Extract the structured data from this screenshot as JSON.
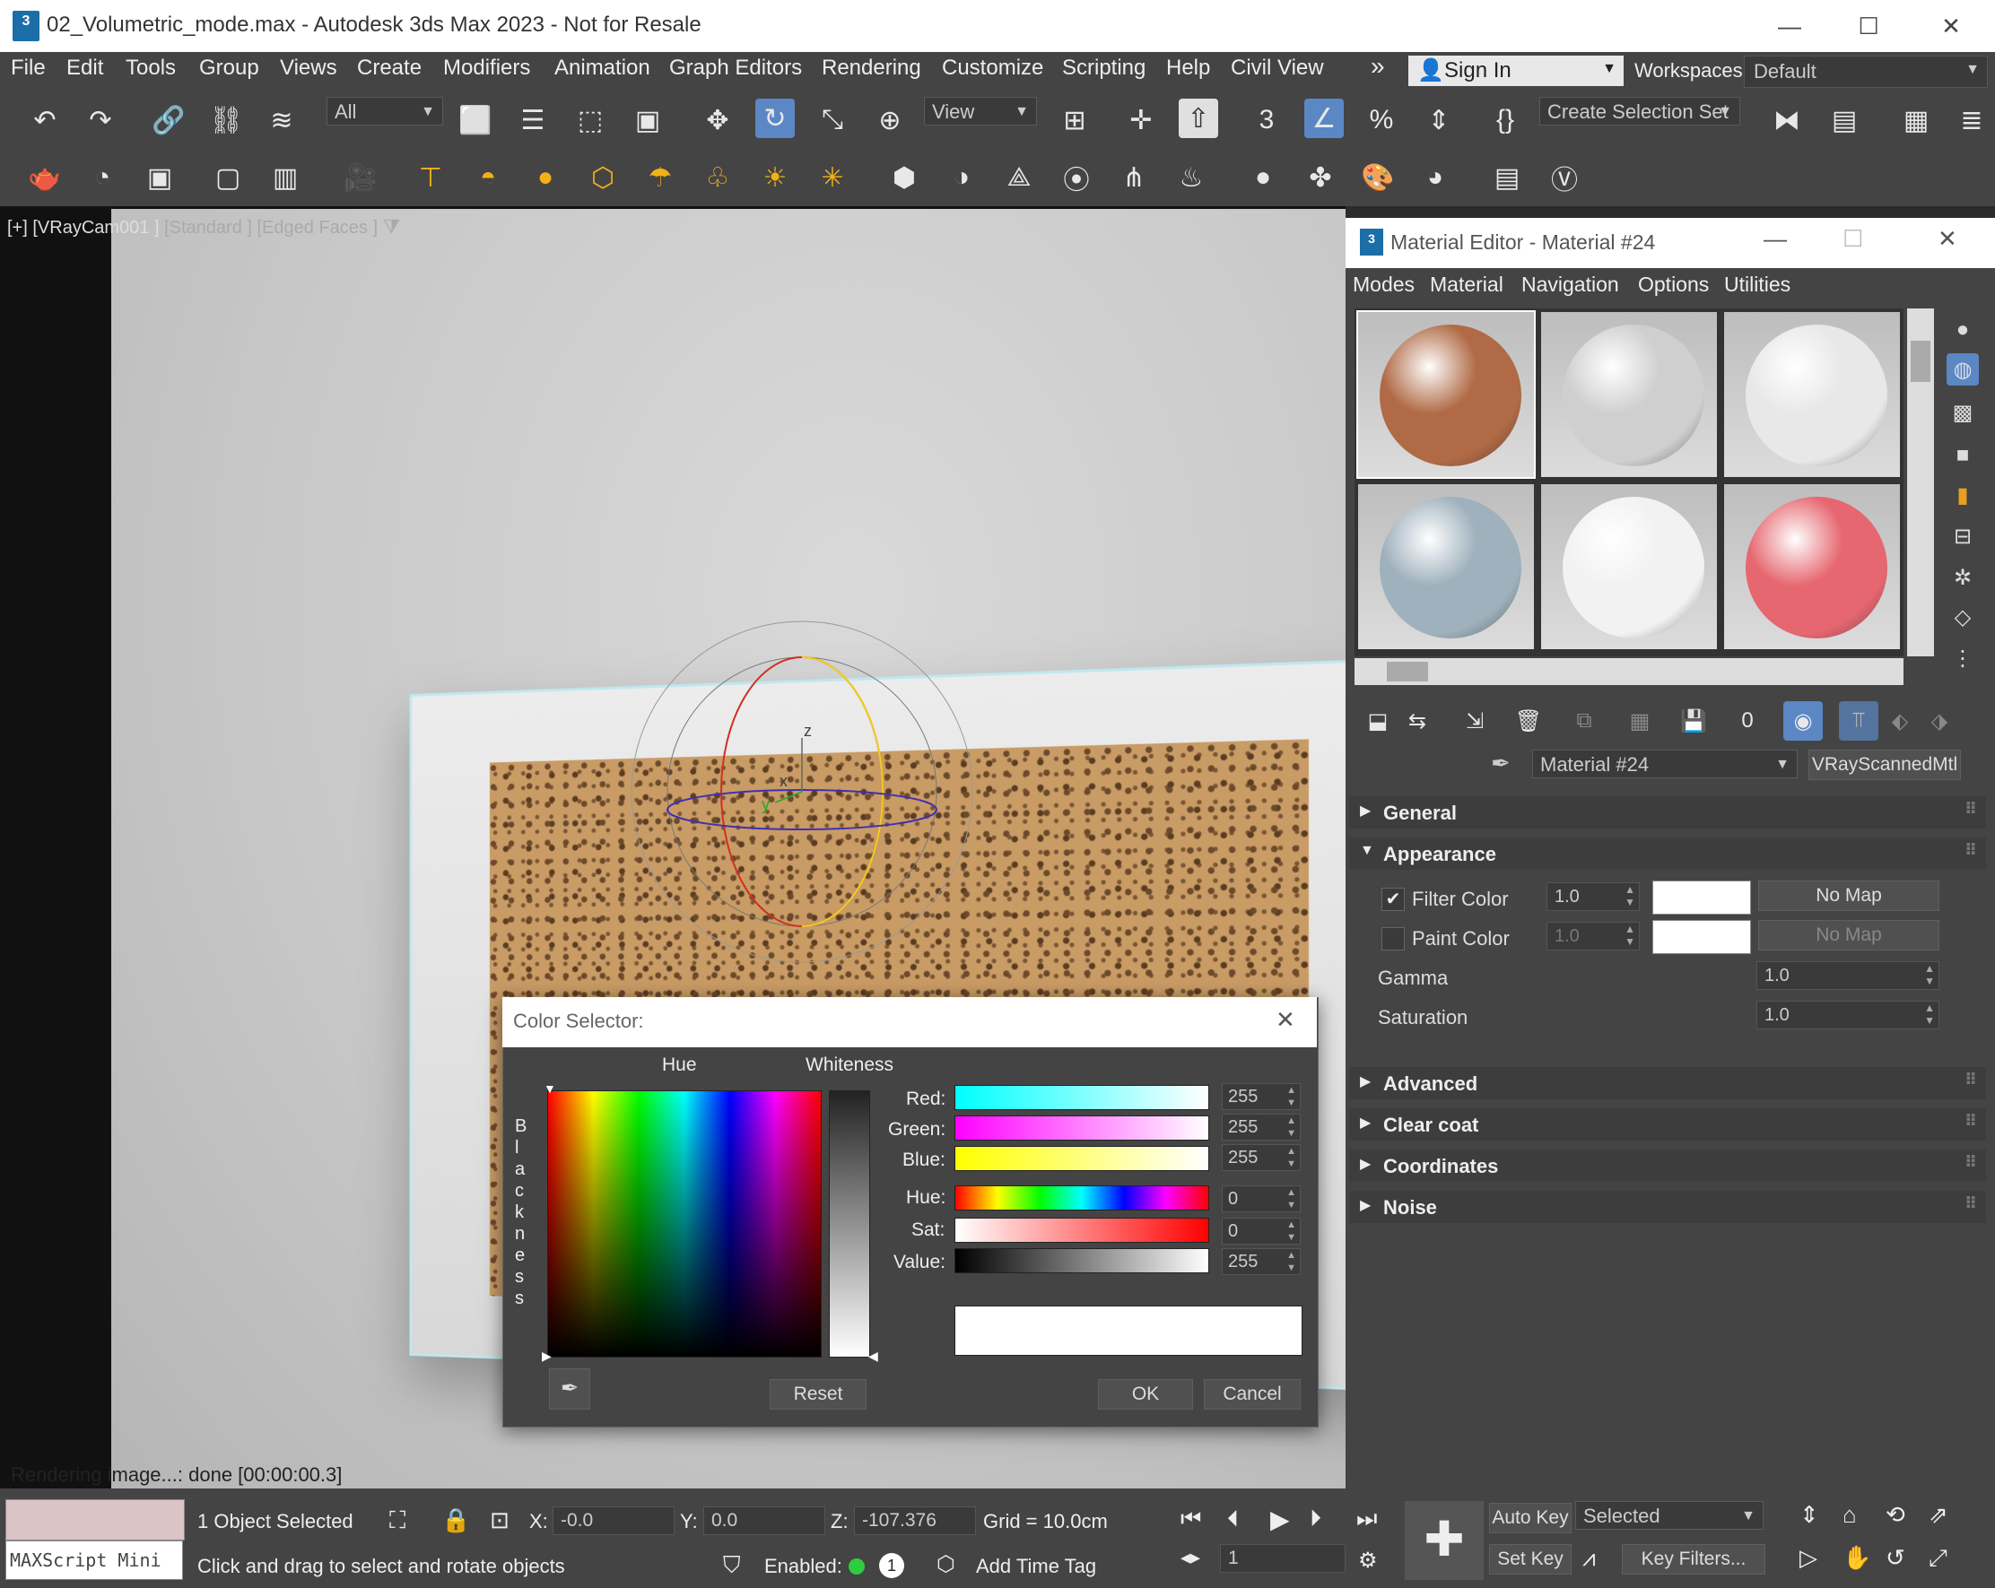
{
  "window": {
    "app_icon": "3",
    "title": "02_Volumetric_mode.max - Autodesk 3ds Max 2023 - Not for Resale",
    "minimize": "—",
    "maximize": "☐",
    "close": "✕"
  },
  "menubar": {
    "items": [
      "File",
      "Edit",
      "Tools",
      "Group",
      "Views",
      "Create",
      "Modifiers",
      "Animation",
      "Graph Editors",
      "Rendering",
      "Customize",
      "Scripting",
      "Help",
      "Civil View"
    ],
    "overflow": "»",
    "sign_in": "Sign In",
    "workspaces_label": "Workspaces:",
    "workspaces_value": "Default"
  },
  "toolbar1": {
    "selection_filter": "All",
    "reference_coord": "View",
    "selection_set": "Create Selection Set"
  },
  "viewport": {
    "label_plus": "[+]",
    "label_camera": "[VRayCam001 ]",
    "label_shading": "[Standard ]",
    "label_faces": "[Edged Faces ]",
    "status": "Rendering image...: done [00:00:00.3]",
    "gizmo_x": "x",
    "gizmo_y": "y",
    "gizmo_z": "z"
  },
  "material_editor": {
    "title": "Material Editor - Material #24",
    "menus": [
      "Modes",
      "Material",
      "Navigation",
      "Options",
      "Utilities"
    ],
    "material_name": "Material #24",
    "material_type": "VRayScannedMtl",
    "rollouts": {
      "general": "General",
      "appearance": "Appearance",
      "advanced": "Advanced",
      "clear_coat": "Clear coat",
      "coordinates": "Coordinates",
      "noise": "Noise"
    },
    "filter_color_label": "Filter Color",
    "filter_color_value": "1.0",
    "filter_color_map": "No Map",
    "paint_color_label": "Paint Color",
    "paint_color_value": "1.0",
    "paint_color_map": "No Map",
    "gamma_label": "Gamma",
    "gamma_value": "1.0",
    "saturation_label": "Saturation",
    "saturation_value": "1.0",
    "swatch_colors": [
      "#b06a45",
      "#cfcfcf",
      "#e8e8e8",
      "#9fb1bd",
      "#f2f2f2",
      "#e66770"
    ]
  },
  "color_selector": {
    "title": "Color Selector:",
    "hue_label": "Hue",
    "whiteness_label": "Whiteness",
    "blackness_label": "Blackness",
    "red_label": "Red:",
    "red_value": "255",
    "green_label": "Green:",
    "green_value": "255",
    "blue_label": "Blue:",
    "blue_value": "255",
    "hue2_label": "Hue:",
    "hue_value": "0",
    "sat_label": "Sat:",
    "sat_value": "0",
    "value_label": "Value:",
    "value_value": "255",
    "current_color": "#ffffff",
    "reset": "Reset",
    "ok": "OK",
    "cancel": "Cancel"
  },
  "statusbar": {
    "maxscript": "MAXScript Mini",
    "selection": "1 Object Selected",
    "prompt": "Click and drag to select and rotate objects",
    "x_label": "X:",
    "x_value": "-0.0",
    "y_label": "Y:",
    "y_value": "0.0",
    "z_label": "Z:",
    "z_value": "-107.376",
    "grid": "Grid = 10.0cm",
    "enabled_label": "Enabled:",
    "enabled_count": "1",
    "add_time_tag": "Add Time Tag",
    "frame_value": "1",
    "auto_key": "Auto Key",
    "set_key": "Set Key",
    "key_mode": "Selected",
    "key_filters": "Key Filters..."
  }
}
